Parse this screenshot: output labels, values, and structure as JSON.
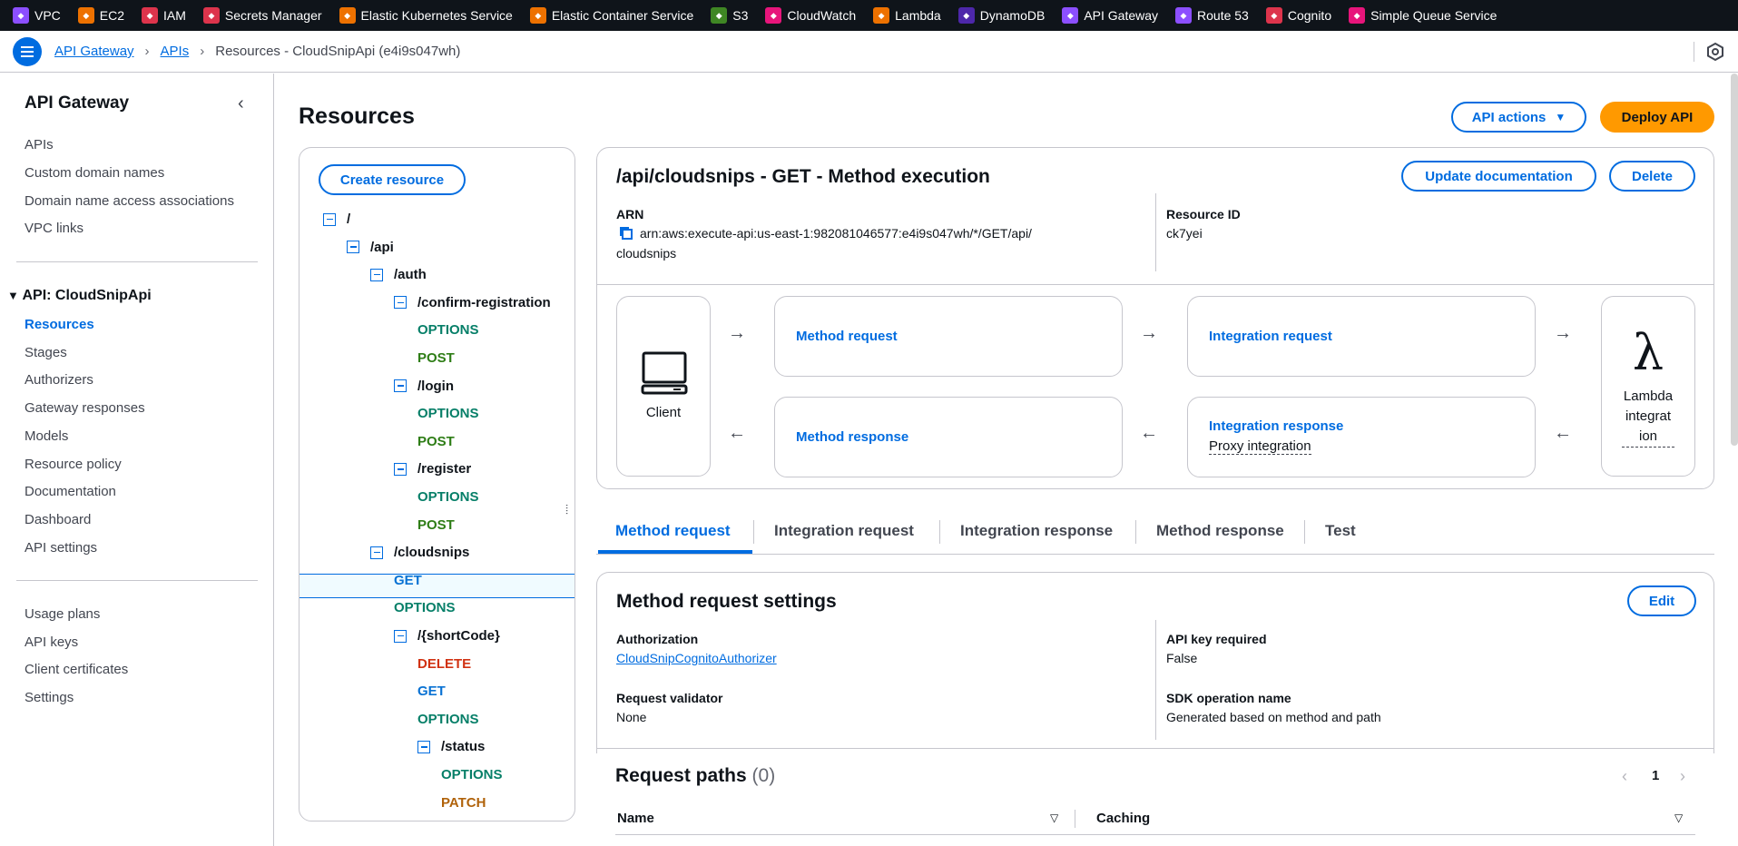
{
  "services": [
    {
      "label": "VPC",
      "color": "#8c4fff",
      "icon": "vpc-icon"
    },
    {
      "label": "EC2",
      "color": "#ed7100",
      "icon": "ec2-icon"
    },
    {
      "label": "IAM",
      "color": "#dd344c",
      "icon": "iam-icon"
    },
    {
      "label": "Secrets Manager",
      "color": "#dd344c",
      "icon": "secrets-manager-icon"
    },
    {
      "label": "Elastic Kubernetes Service",
      "color": "#ed7100",
      "icon": "eks-icon"
    },
    {
      "label": "Elastic Container Service",
      "color": "#ed7100",
      "icon": "ecs-icon"
    },
    {
      "label": "S3",
      "color": "#3f8624",
      "icon": "s3-icon"
    },
    {
      "label": "CloudWatch",
      "color": "#e7157b",
      "icon": "cloudwatch-icon"
    },
    {
      "label": "Lambda",
      "color": "#ed7100",
      "icon": "lambda-icon"
    },
    {
      "label": "DynamoDB",
      "color": "#4d27aa",
      "icon": "dynamodb-icon"
    },
    {
      "label": "API Gateway",
      "color": "#8c4fff",
      "icon": "api-gateway-icon"
    },
    {
      "label": "Route 53",
      "color": "#8c4fff",
      "icon": "route53-icon"
    },
    {
      "label": "Cognito",
      "color": "#dd344c",
      "icon": "cognito-icon"
    },
    {
      "label": "Simple Queue Service",
      "color": "#e7157b",
      "icon": "sqs-icon"
    }
  ],
  "breadcrumb": {
    "root": "API Gateway",
    "apis": "APIs",
    "current": "Resources - CloudSnipApi (e4i9s047wh)"
  },
  "sidebar": {
    "title": "API Gateway",
    "top_items": [
      "APIs",
      "Custom domain names",
      "Domain name access associations",
      "VPC links"
    ],
    "section": "API: CloudSnipApi",
    "api_items": [
      "Resources",
      "Stages",
      "Authorizers",
      "Gateway responses",
      "Models",
      "Resource policy",
      "Documentation",
      "Dashboard",
      "API settings"
    ],
    "bottom_items": [
      "Usage plans",
      "API keys",
      "Client certificates",
      "Settings"
    ]
  },
  "page": {
    "title": "Resources",
    "api_actions": "API actions",
    "deploy": "Deploy API",
    "create_resource": "Create resource"
  },
  "tree": [
    {
      "label": "/",
      "kind": "res"
    },
    {
      "label": "/api",
      "kind": "res"
    },
    {
      "label": "/auth",
      "kind": "res"
    },
    {
      "label": "/confirm-registration",
      "kind": "res"
    },
    {
      "label": "OPTIONS",
      "kind": "options"
    },
    {
      "label": "POST",
      "kind": "post"
    },
    {
      "label": "/login",
      "kind": "res"
    },
    {
      "label": "OPTIONS",
      "kind": "options"
    },
    {
      "label": "POST",
      "kind": "post"
    },
    {
      "label": "/register",
      "kind": "res"
    },
    {
      "label": "OPTIONS",
      "kind": "options"
    },
    {
      "label": "POST",
      "kind": "post"
    },
    {
      "label": "/cloudsnips",
      "kind": "res"
    },
    {
      "label": "GET",
      "kind": "get"
    },
    {
      "label": "OPTIONS",
      "kind": "options"
    },
    {
      "label": "/{shortCode}",
      "kind": "res"
    },
    {
      "label": "DELETE",
      "kind": "delete"
    },
    {
      "label": "GET",
      "kind": "get"
    },
    {
      "label": "OPTIONS",
      "kind": "options"
    },
    {
      "label": "/status",
      "kind": "res"
    },
    {
      "label": "OPTIONS",
      "kind": "options"
    },
    {
      "label": "PATCH",
      "kind": "patch"
    }
  ],
  "method": {
    "title": "/api/cloudsnips - GET - Method execution",
    "update_doc": "Update documentation",
    "delete": "Delete",
    "arn_label": "ARN",
    "arn_line1": "arn:aws:execute-api:us-east-1:982081046577:e4i9s047wh/*/GET/api/",
    "arn_line2": "cloudsnips",
    "resource_id_label": "Resource ID",
    "resource_id": "ck7yei"
  },
  "flow": {
    "client": "Client",
    "method_request": "Method request",
    "integration_request": "Integration request",
    "method_response": "Method response",
    "integration_response": "Integration response",
    "proxy": "Proxy integration",
    "lambda_l1": "Lambda",
    "lambda_l2": "integrat",
    "lambda_l3": "ion"
  },
  "tabs": [
    "Method request",
    "Integration request",
    "Integration response",
    "Method response",
    "Test"
  ],
  "settings": {
    "title": "Method request settings",
    "edit": "Edit",
    "authorization_label": "Authorization",
    "authorization": "CloudSnipCognitoAuthorizer",
    "api_key_label": "API key required",
    "api_key": "False",
    "validator_label": "Request validator",
    "validator": "None",
    "sdk_label": "SDK operation name",
    "sdk": "Generated based on method and path"
  },
  "request_paths": {
    "title": "Request paths",
    "count": "(0)",
    "page": "1",
    "col_name": "Name",
    "col_caching": "Caching"
  }
}
